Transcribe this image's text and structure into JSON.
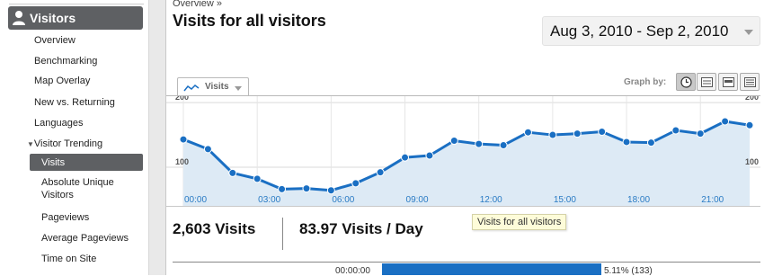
{
  "sidebar": {
    "header": "Visitors",
    "items": [
      {
        "label": "Overview"
      },
      {
        "label": "Benchmarking"
      },
      {
        "label": "Map Overlay"
      },
      {
        "label": "New vs. Returning"
      },
      {
        "label": "Languages"
      },
      {
        "label": "Visitor Trending"
      },
      {
        "label": "Visits"
      },
      {
        "label": "Absolute Unique"
      },
      {
        "label": "Visitors"
      },
      {
        "label": "Pageviews"
      },
      {
        "label": "Average Pageviews"
      },
      {
        "label": "Time on Site"
      }
    ]
  },
  "header": {
    "breadcrumb": "Overview »",
    "title": "Visits for all visitors",
    "date_range": "Aug 3, 2010 - Sep 2, 2010"
  },
  "graph_tab": {
    "label": "Visits",
    "graph_by_label": "Graph by:"
  },
  "chart_data": {
    "type": "area",
    "y_ticks": [
      {
        "value": 200,
        "label": "200"
      },
      {
        "value": 100,
        "label": "100"
      }
    ],
    "x_tick_labels": [
      "00:00",
      "03:00",
      "06:00",
      "09:00",
      "12:00",
      "15:00",
      "18:00",
      "21:00"
    ],
    "x": [
      0,
      1,
      2,
      3,
      4,
      5,
      6,
      7,
      8,
      9,
      10,
      11,
      12,
      13,
      14,
      15,
      16,
      17,
      18,
      19,
      20,
      21,
      22,
      23
    ],
    "series": [
      {
        "values": [
          143,
          128,
          91,
          82,
          66,
          67,
          64,
          75,
          92,
          115,
          118,
          141,
          136,
          134,
          154,
          150,
          152,
          155,
          139,
          138,
          157,
          152,
          171,
          165
        ]
      }
    ],
    "ylim": [
      40,
      210
    ],
    "colors": {
      "line": "#1a6fc3",
      "fill": "#ddeaf5"
    }
  },
  "stats": {
    "visits": "2,603 Visits",
    "visits_per_day": "83.97 Visits / Day",
    "tooltip": "Visits for all visitors"
  },
  "bottom_row": {
    "time": "00:00:00",
    "percent": "5.11% (133)"
  }
}
